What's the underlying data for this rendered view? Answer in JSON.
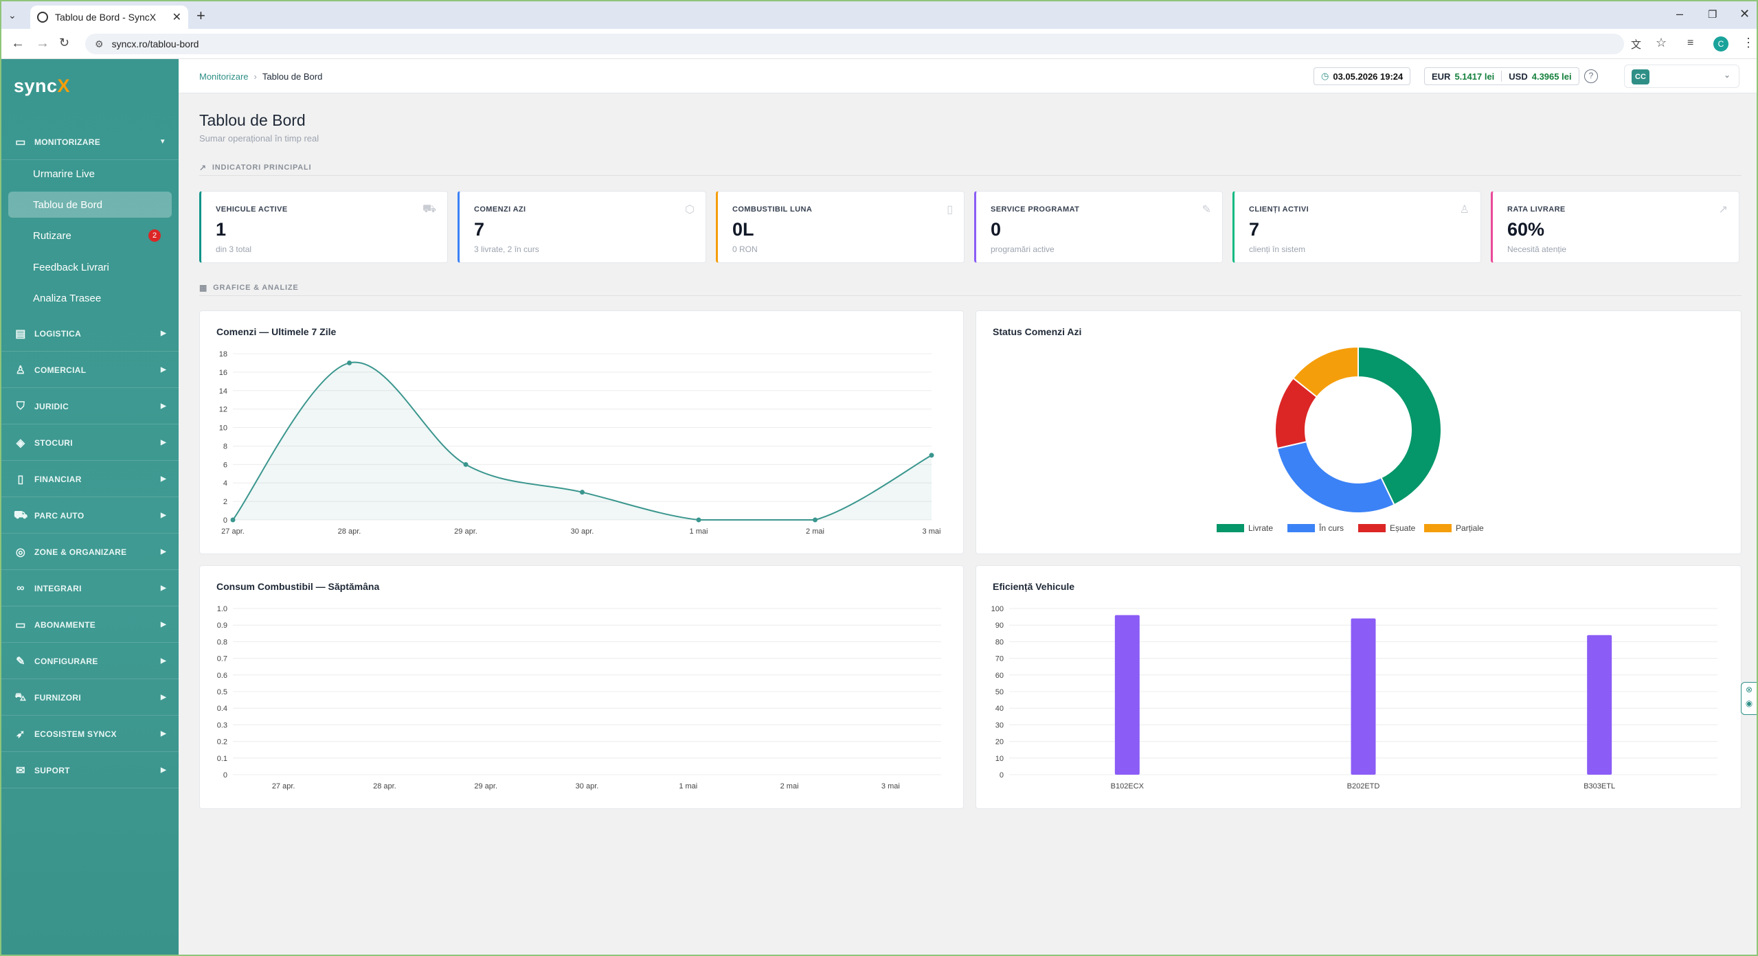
{
  "browser": {
    "tab_title": "Tablou de Bord - SyncX",
    "url": "syncx.ro/tablou-bord",
    "profile_initial": "C"
  },
  "brand": {
    "name_main": "sync",
    "name_accent": "X"
  },
  "sidebar": {
    "sections": [
      {
        "label": "MONITORIZARE",
        "icon": "monitor-icon",
        "expanded": true
      },
      {
        "label": "LOGISTICA",
        "icon": "clipboard-icon"
      },
      {
        "label": "COMERCIAL",
        "icon": "users-icon"
      },
      {
        "label": "JURIDIC",
        "icon": "shield-icon"
      },
      {
        "label": "STOCURI",
        "icon": "layers-icon"
      },
      {
        "label": "FINANCIAR",
        "icon": "document-icon"
      },
      {
        "label": "PARC AUTO",
        "icon": "truck-icon"
      },
      {
        "label": "ZONE & ORGANIZARE",
        "icon": "map-pin-icon"
      },
      {
        "label": "INTEGRARI",
        "icon": "link-icon"
      },
      {
        "label": "ABONAMENTE",
        "icon": "card-icon"
      },
      {
        "label": "CONFIGURARE",
        "icon": "wrench-icon"
      },
      {
        "label": "FURNIZORI",
        "icon": "cart-icon"
      },
      {
        "label": "ECOSISTEM SYNCX",
        "icon": "rocket-icon"
      },
      {
        "label": "SUPORT",
        "icon": "mail-icon"
      }
    ],
    "monitorizare_items": [
      {
        "label": "Urmarire Live"
      },
      {
        "label": "Tablou de Bord",
        "active": true
      },
      {
        "label": "Rutizare",
        "badge": "2"
      },
      {
        "label": "Feedback Livrari"
      },
      {
        "label": "Analiza Trasee"
      }
    ]
  },
  "topbar": {
    "breadcrumb_parent": "Monitorizare",
    "breadcrumb_current": "Tablou de Bord",
    "datetime": "03.05.2026 19:24",
    "eur_label": "EUR",
    "eur_value": "5.1417 lei",
    "usd_label": "USD",
    "usd_value": "4.3965 lei",
    "help": "?",
    "user_initials": "CC"
  },
  "page": {
    "title": "Tablou de Bord",
    "subtitle": "Sumar operațional în timp real",
    "section_kpi": "INDICATORI PRINCIPALI",
    "section_charts": "GRAFICE & ANALIZE"
  },
  "kpis": [
    {
      "label": "VEHICULE ACTIVE",
      "value": "1",
      "sub": "din 3 total",
      "color": "#0d9488",
      "icon": "truck-icon"
    },
    {
      "label": "COMENZI AZI",
      "value": "7",
      "sub": "3 livrate, 2 în curs",
      "color": "#3b82f6",
      "icon": "box-icon"
    },
    {
      "label": "COMBUSTIBIL LUNA",
      "value": "0L",
      "sub": "0 RON",
      "color": "#f59e0b",
      "icon": "fuel-icon"
    },
    {
      "label": "SERVICE PROGRAMAT",
      "value": "0",
      "sub": "programări active",
      "color": "#8b5cf6",
      "icon": "wrench-icon"
    },
    {
      "label": "CLIENȚI ACTIVI",
      "value": "7",
      "sub": "clienți în sistem",
      "color": "#10b981",
      "icon": "users-icon"
    },
    {
      "label": "RATA LIVRARE",
      "value": "60%",
      "sub": "Necesită atenție",
      "color": "#ec4899",
      "icon": "trend-icon"
    }
  ],
  "chart_data": [
    {
      "type": "area",
      "title": "Comenzi — Ultimele 7 Zile",
      "x": [
        "27 apr.",
        "28 apr.",
        "29 apr.",
        "30 apr.",
        "1 mai",
        "2 mai",
        "3 mai"
      ],
      "series": [
        {
          "values": [
            0,
            17,
            6,
            3,
            0,
            0,
            7
          ]
        }
      ],
      "ylim": [
        0,
        18
      ],
      "yticks": [
        0,
        2,
        4,
        6,
        8,
        10,
        12,
        14,
        16,
        18
      ],
      "color": "#3a968e",
      "grid": true
    },
    {
      "type": "pie",
      "title": "Status Comenzi Azi",
      "donut": true,
      "categories": [
        "Livrate",
        "În curs",
        "Eșuate",
        "Parțiale"
      ],
      "values": [
        3,
        2,
        1,
        1
      ],
      "colors": [
        "#059669",
        "#3b82f6",
        "#dc2626",
        "#f59e0b"
      ],
      "legend": "bottom"
    },
    {
      "type": "bar",
      "title": "Consum Combustibil — Săptămâna",
      "categories": [
        "27 apr.",
        "28 apr.",
        "29 apr.",
        "30 apr.",
        "1 mai",
        "2 mai",
        "3 mai"
      ],
      "values": [
        0,
        0,
        0,
        0,
        0,
        0,
        0
      ],
      "ylim": [
        0,
        1
      ],
      "yticks": [
        "0",
        "0.1",
        "0.2",
        "0.3",
        "0.4",
        "0.5",
        "0.6",
        "0.7",
        "0.8",
        "0.9",
        "1.0"
      ],
      "grid": true
    },
    {
      "type": "bar",
      "title": "Eficiență Vehicule",
      "categories": [
        "B102ECX",
        "B202ETD",
        "B303ETL"
      ],
      "values": [
        96,
        94,
        84
      ],
      "ylim": [
        0,
        100
      ],
      "yticks": [
        0,
        10,
        20,
        30,
        40,
        50,
        60,
        70,
        80,
        90,
        100
      ],
      "color": "#8b5cf6",
      "grid": true
    }
  ]
}
